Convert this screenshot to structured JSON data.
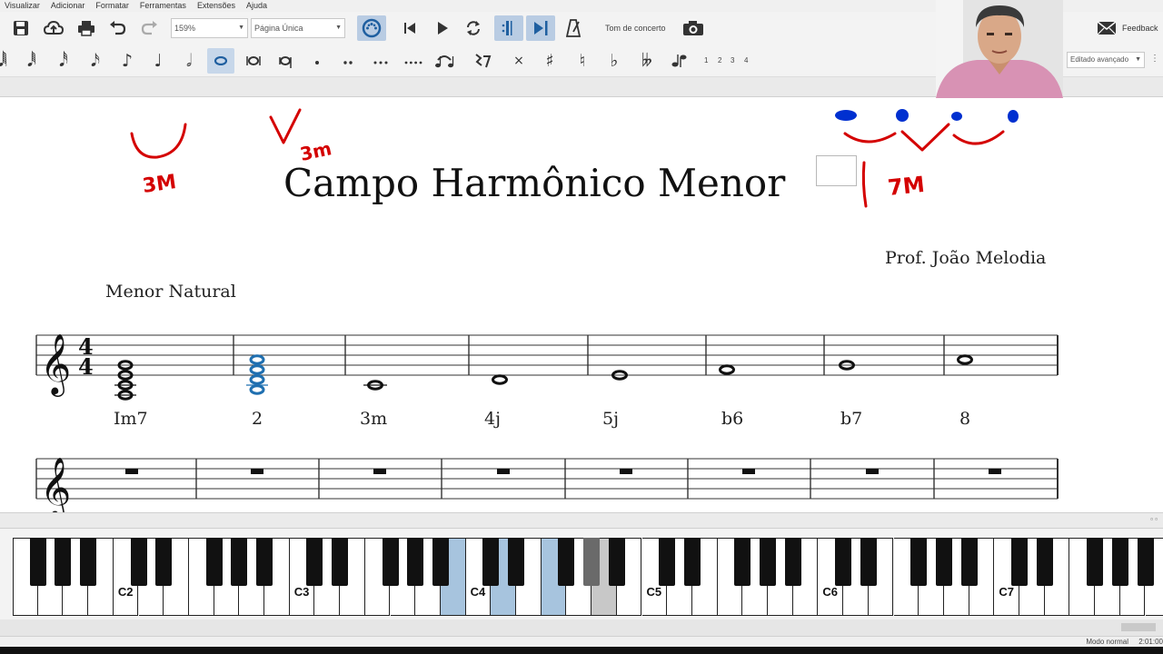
{
  "menu": [
    "Visualizar",
    "Adicionar",
    "Formatar",
    "Ferramentas",
    "Extensões",
    "Ajuda"
  ],
  "toolbar": {
    "zoom": "159%",
    "view_mode": "Página Única",
    "concert_pitch": "Tom de concerto",
    "feedback": "Feedback"
  },
  "note_toolbar": {
    "voices": [
      "1",
      "2",
      "3",
      "4"
    ],
    "workspace": "Editado avançado"
  },
  "score": {
    "title": "Campo Harmônico Menor",
    "composer": "Prof. João Melodia",
    "subtitle": "Menor Natural",
    "time_signature": [
      "4",
      "4"
    ],
    "chord_labels": [
      "Im7",
      "2",
      "3m",
      "4j",
      "5j",
      "b6",
      "b7",
      "8"
    ]
  },
  "annotations": [
    "3M",
    "3m",
    "7M"
  ],
  "piano": {
    "octave_labels": [
      "C2",
      "C3",
      "C4",
      "C5",
      "C6",
      "C7"
    ]
  },
  "status": {
    "mode": "Modo normal",
    "time": "2:01:00"
  },
  "colors": {
    "highlight_key": "#a7c4de",
    "selected_note": "#1f6fb0",
    "ink_red": "#d40000",
    "ink_blue": "#0030d0"
  }
}
